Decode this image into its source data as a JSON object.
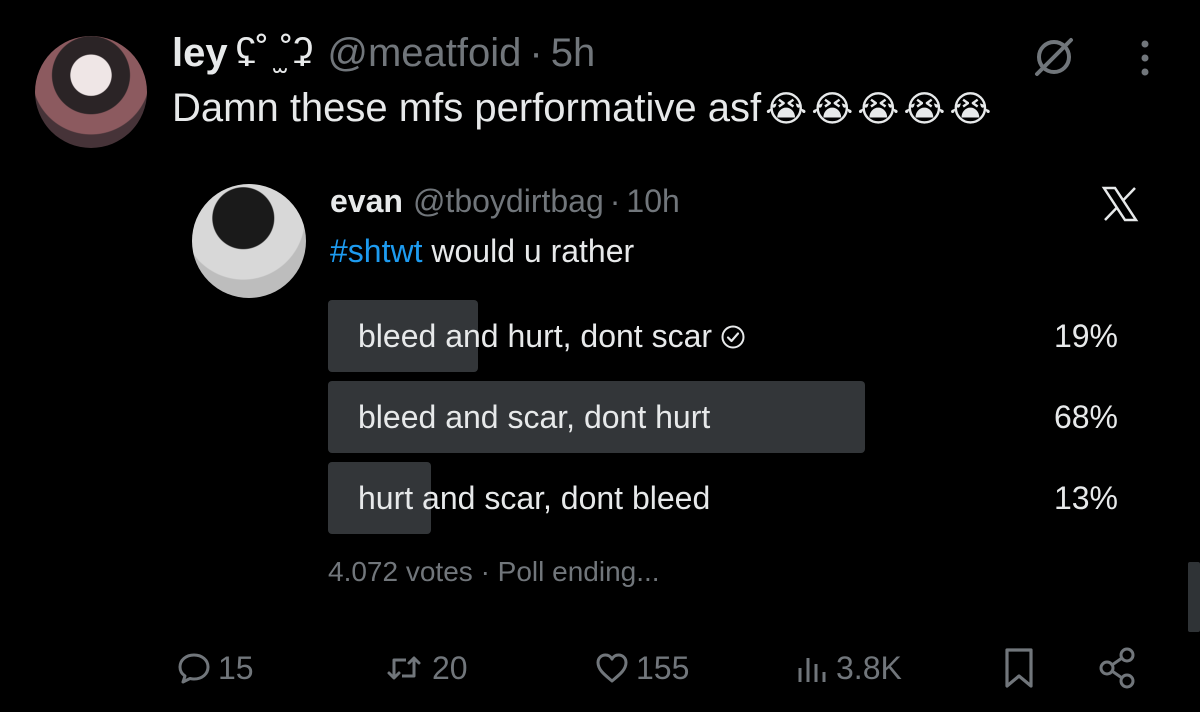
{
  "tweet": {
    "display_name": "ley",
    "name_kaomoji": "ʢ˚ ̫˚ʡ",
    "handle": "@meatfoid",
    "separator": "·",
    "time": "5h",
    "text": "Damn these mfs performative asf",
    "emojis": [
      "😭",
      "😭",
      "😭",
      "😭",
      "😭"
    ]
  },
  "quoted": {
    "display_name": "evan",
    "handle": "@tboydirtbag",
    "separator": "·",
    "time": "10h",
    "hashtag": "#shtwt",
    "text": " would u rather"
  },
  "poll": {
    "options": [
      {
        "label": "bleed and hurt, dont scar",
        "percent": 19,
        "percent_label": "19%",
        "selected": true
      },
      {
        "label": "bleed and scar, dont hurt",
        "percent": 68,
        "percent_label": "68%",
        "selected": false
      },
      {
        "label": "hurt and scar, dont bleed",
        "percent": 13,
        "percent_label": "13%",
        "selected": false
      }
    ],
    "votes": "4.072 votes",
    "separator": "·",
    "status": "Poll ending..."
  },
  "actions": {
    "replies": "15",
    "retweets": "20",
    "likes": "155",
    "views": "3.8K"
  },
  "colors": {
    "background": "#000000",
    "text": "#e7e9ea",
    "muted": "#71767b",
    "hashtag": "#1d9bf0",
    "poll_fill": "#333639"
  },
  "icons": [
    "grok-icon",
    "more-icon",
    "x-logo-icon",
    "check-circle-icon",
    "reply-icon",
    "retweet-icon",
    "like-icon",
    "views-icon",
    "bookmark-icon",
    "share-icon"
  ]
}
